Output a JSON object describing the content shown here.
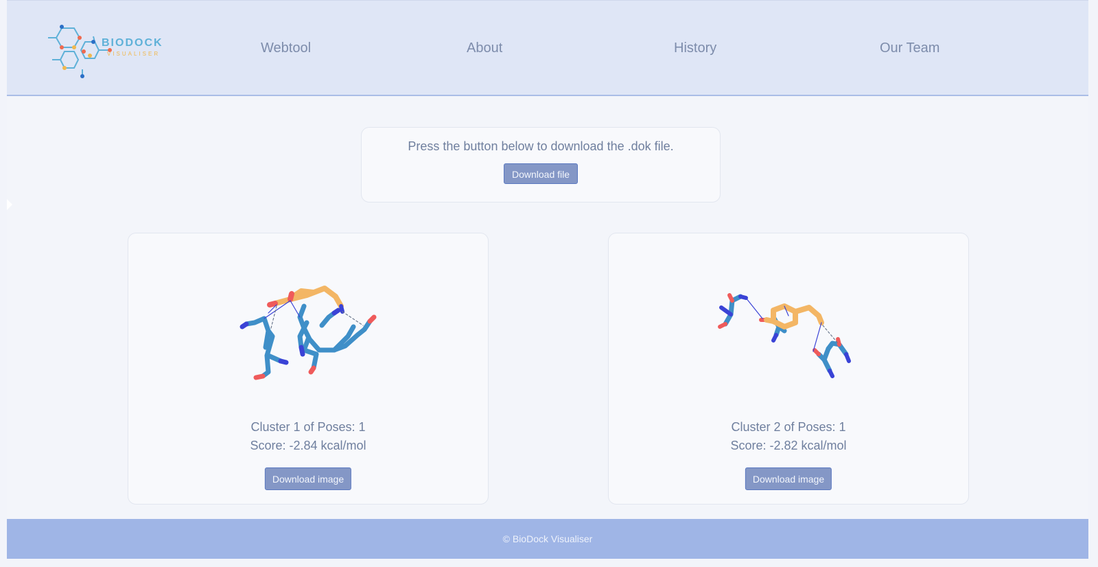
{
  "header": {
    "logo": {
      "title": "BIODOCK",
      "subtitle": "VISUALISER"
    },
    "nav": [
      {
        "label": "Webtool"
      },
      {
        "label": "About"
      },
      {
        "label": "History"
      },
      {
        "label": "Our Team"
      }
    ]
  },
  "download_panel": {
    "message": "Press the button below to download the .dok file.",
    "button_label": "Download file"
  },
  "clusters": [
    {
      "title": "Cluster 1 of Poses: 1",
      "score": "Score: -2.84 kcal/mol",
      "button_label": "Download image"
    },
    {
      "title": "Cluster 2 of Poses: 1",
      "score": "Score: -2.82 kcal/mol",
      "button_label": "Download image"
    }
  ],
  "footer": {
    "text": "© BioDock Visualiser"
  },
  "colors": {
    "header_bg": "#dfe6f6",
    "footer_bg": "#9fb5e6",
    "button_bg": "#8497c6",
    "ligand": "#f3b665",
    "protein": "#3f8fc8",
    "nitrogen": "#3a43d6",
    "oxygen": "#ef5b5b"
  }
}
